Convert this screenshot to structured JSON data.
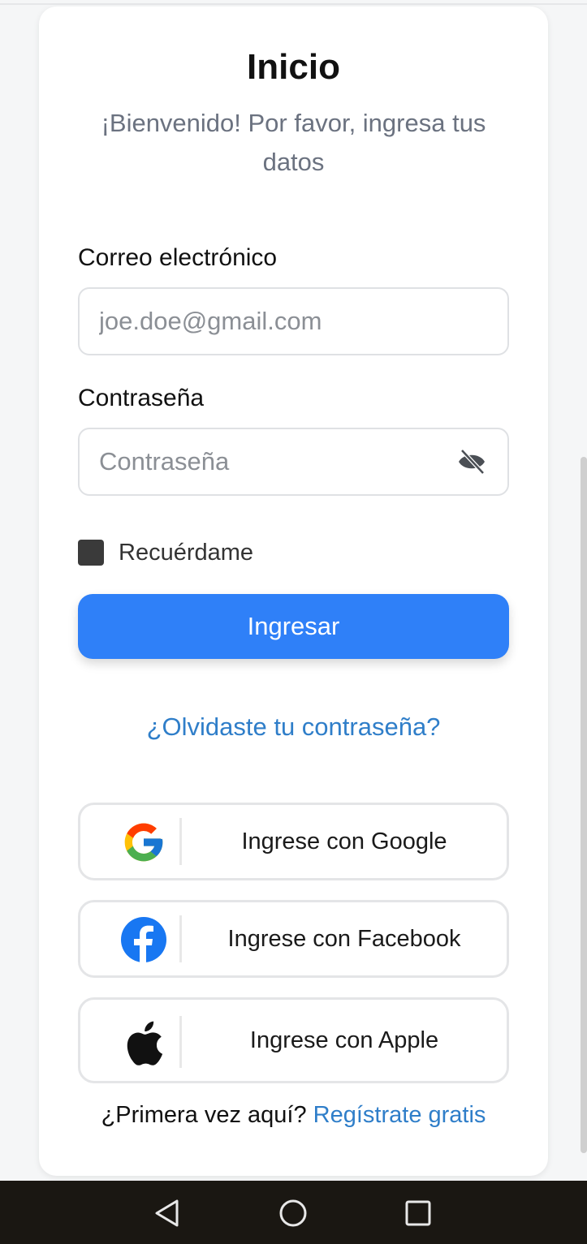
{
  "header": {
    "title": "Inicio",
    "subtitle": "¡Bienvenido! Por favor, ingresa tus datos"
  },
  "form": {
    "email_label": "Correo electrónico",
    "email_placeholder": "joe.doe@gmail.com",
    "password_label": "Contraseña",
    "password_placeholder": "Contraseña",
    "password_toggle_icon": "eye-off-icon",
    "remember_label": "Recuérdame",
    "submit_label": "Ingresar",
    "forgot_label": "¿Olvidaste tu contraseña?"
  },
  "social": {
    "google_label": "Ingrese con Google",
    "facebook_label": "Ingrese con Facebook",
    "apple_label": "Ingrese con Apple"
  },
  "footer": {
    "prompt": "¿Primera vez aquí?",
    "signup_link": "Regístrate gratis"
  },
  "colors": {
    "primary": "#2f80f8",
    "link": "#2f7ec9"
  }
}
